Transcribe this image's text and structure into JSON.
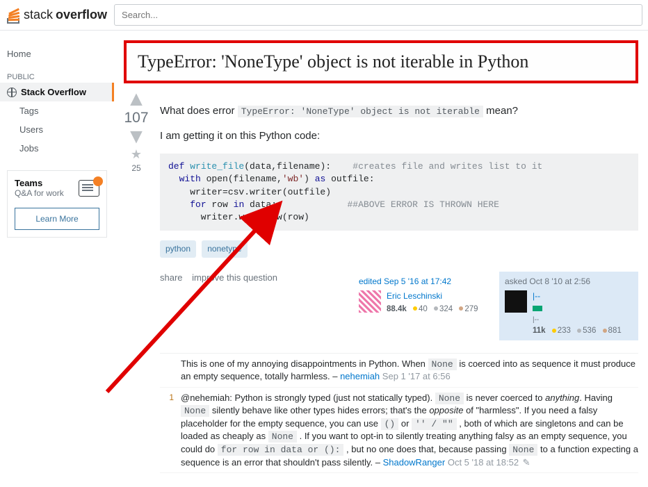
{
  "header": {
    "logo_text_a": "stack",
    "logo_text_b": "overflow",
    "search_placeholder": "Search..."
  },
  "sidebar": {
    "home": "Home",
    "public": "PUBLIC",
    "so": "Stack Overflow",
    "items": [
      "Tags",
      "Users",
      "Jobs"
    ],
    "teams_title": "Teams",
    "teams_sub": "Q&A for work",
    "learn_more": "Learn More"
  },
  "question": {
    "title": "TypeError: 'NoneType' object is not iterable in Python",
    "intro_a": "What does error ",
    "intro_err": "TypeError: 'NoneType' object is not iterable",
    "intro_b": " mean?",
    "para2": "I am getting it on this Python code:",
    "vote_count": "107",
    "fav_count": "25"
  },
  "tags": [
    "python",
    "nonetype"
  ],
  "post_menu": {
    "share": "share",
    "improve": "improve this question"
  },
  "editor": {
    "label": "edited Sep 5 '16 at 17:42",
    "name": "Eric Leschinski",
    "rep": "88.4k",
    "gold": "40",
    "silver": "324",
    "bronze": "279"
  },
  "asker": {
    "label": "asked Oct 8 '10 at 2:56",
    "name": "|--",
    "rep": "11k",
    "gold": "233",
    "silver": "536",
    "bronze": "881"
  },
  "comments": [
    {
      "score": "",
      "text_a": "This is one of my annoying disappointments in Python. When ",
      "code1": "None",
      "text_b": " is coerced into as sequence it must produce an empty sequence, totally harmless. – ",
      "author": "nehemiah",
      "date": "Sep 1 '17 at 6:56"
    },
    {
      "score": "1",
      "author": "ShadowRanger",
      "date": "Oct 5 '18 at 18:52"
    }
  ]
}
